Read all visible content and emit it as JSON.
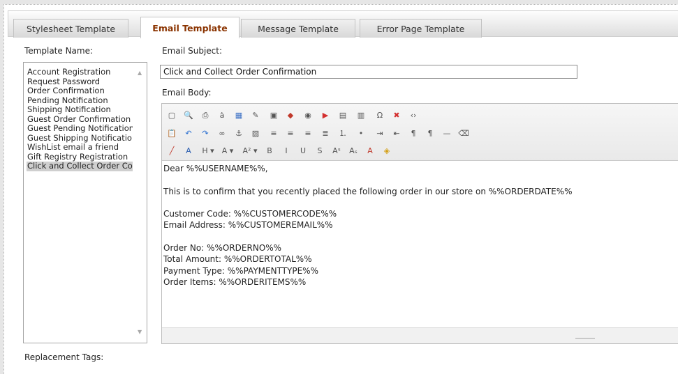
{
  "tabs": [
    {
      "label": "Stylesheet Template",
      "active": false
    },
    {
      "label": "Email Template",
      "active": true
    },
    {
      "label": "Message Template",
      "active": false
    },
    {
      "label": "Error Page Template",
      "active": false
    }
  ],
  "template_name_label": "Template Name:",
  "templates": [
    "Account Registration",
    "Request Password",
    "Order Confirmation",
    "Pending Notification",
    "Shipping Notification",
    "Guest Order Confirmation",
    "Guest Pending Notification",
    "Guest Shipping Notification",
    "WishList email a friend",
    "Gift Registry Registration",
    "Click and Collect Order Confirmation"
  ],
  "selected_template_index": 10,
  "email_subject_label": "Email Subject:",
  "email_subject_value": "Click and Collect Order Confirmation",
  "email_body_label": "Email Body:",
  "replacement_tags_label": "Replacement Tags:",
  "toolbar": {
    "row1": [
      {
        "name": "select-all-icon",
        "glyph": "▢"
      },
      {
        "name": "find-icon",
        "glyph": "🔍"
      },
      {
        "name": "print-icon",
        "glyph": "⎙"
      },
      {
        "name": "replace-icon",
        "glyph": "ȧ"
      },
      {
        "name": "insert-table-icon",
        "glyph": "▦"
      },
      {
        "name": "insert-form-icon",
        "glyph": "✎"
      },
      {
        "name": "insert-image-icon",
        "glyph": "▣"
      },
      {
        "name": "insert-flash-icon",
        "glyph": "◆"
      },
      {
        "name": "insert-media-icon",
        "glyph": "◉"
      },
      {
        "name": "insert-youtube-icon",
        "glyph": "▶"
      },
      {
        "name": "insert-document-icon",
        "glyph": "▤"
      },
      {
        "name": "template-icon",
        "glyph": "▥"
      },
      {
        "name": "special-character-icon",
        "glyph": "Ω"
      },
      {
        "name": "remove-format-icon",
        "glyph": "✖"
      },
      {
        "name": "html-source-icon",
        "glyph": "‹›"
      }
    ],
    "row2": [
      {
        "name": "paste-icon",
        "glyph": "📋"
      },
      {
        "name": "undo-icon",
        "glyph": "↶"
      },
      {
        "name": "redo-icon",
        "glyph": "↷"
      },
      {
        "name": "link-icon",
        "glyph": "∞"
      },
      {
        "name": "anchor-icon",
        "glyph": "⚓"
      },
      {
        "name": "image-icon",
        "glyph": "▨"
      },
      {
        "name": "align-left-icon",
        "glyph": "≡"
      },
      {
        "name": "align-center-icon",
        "glyph": "≡"
      },
      {
        "name": "align-right-icon",
        "glyph": "≡"
      },
      {
        "name": "align-justify-icon",
        "glyph": "≣"
      },
      {
        "name": "ordered-list-icon",
        "glyph": "⒈"
      },
      {
        "name": "unordered-list-icon",
        "glyph": "•"
      },
      {
        "name": "indent-icon",
        "glyph": "⇥"
      },
      {
        "name": "outdent-icon",
        "glyph": "⇤"
      },
      {
        "name": "ltr-icon",
        "glyph": "¶"
      },
      {
        "name": "rtl-icon",
        "glyph": "¶"
      },
      {
        "name": "horizontal-rule-icon",
        "glyph": "—"
      },
      {
        "name": "eraser-icon",
        "glyph": "⌫"
      }
    ],
    "row3": [
      {
        "name": "brush-icon",
        "glyph": "╱"
      },
      {
        "name": "style-icon",
        "glyph": "A"
      },
      {
        "name": "heading-dropdown",
        "glyph": "H ▾"
      },
      {
        "name": "font-dropdown",
        "glyph": "A ▾"
      },
      {
        "name": "font-size-dropdown",
        "glyph": "A² ▾"
      },
      {
        "name": "bold-icon",
        "glyph": "B"
      },
      {
        "name": "italic-icon",
        "glyph": "I"
      },
      {
        "name": "underline-icon",
        "glyph": "U"
      },
      {
        "name": "strikethrough-icon",
        "glyph": "S"
      },
      {
        "name": "superscript-icon",
        "glyph": "Aˢ"
      },
      {
        "name": "subscript-icon",
        "glyph": "Aₛ"
      },
      {
        "name": "font-color-icon",
        "glyph": "A"
      },
      {
        "name": "highlight-icon",
        "glyph": "◈"
      }
    ]
  },
  "body_lines": [
    "Dear %%USERNAME%%,",
    "",
    "This is to confirm that you recently placed the following order in our store on %%ORDERDATE%%",
    "",
    "Customer Code: %%CUSTOMERCODE%%",
    "Email Address: %%CUSTOMEREMAIL%%",
    "",
    "Order No: %%ORDERNO%%",
    "Total Amount: %%ORDERTOTAL%%",
    "Payment Type: %%PAYMENTTYPE%%",
    "Order Items: %%ORDERITEMS%%"
  ],
  "colors": {
    "active_tab_text": "#8a3300",
    "selected_item_bg": "#cfcfcf"
  }
}
